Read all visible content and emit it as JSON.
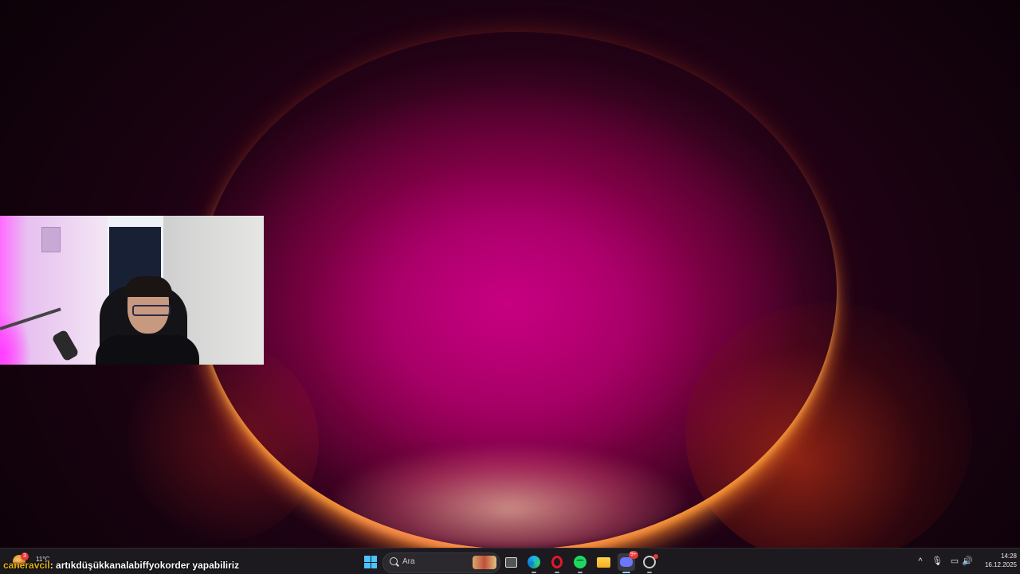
{
  "weather": {
    "temperature": "11°C",
    "badge": "3",
    "icon": "weather-sun-icon"
  },
  "chat": {
    "user": "caneravcil",
    "message": ": artıkdüşükkanalabiffyokorder yapabiliriz"
  },
  "taskbar": {
    "search_placeholder": "Ara",
    "apps": [
      {
        "name": "Windows Start",
        "icon": "windows-logo-icon"
      },
      {
        "name": "Task View",
        "icon": "task-view-icon"
      },
      {
        "name": "Microsoft Edge",
        "icon": "edge-icon"
      },
      {
        "name": "Opera GX",
        "icon": "opera-icon"
      },
      {
        "name": "Spotify",
        "icon": "spotify-icon"
      },
      {
        "name": "File Explorer",
        "icon": "folder-icon"
      },
      {
        "name": "Discord",
        "icon": "discord-icon",
        "badge": "9+"
      },
      {
        "name": "GitHub Desktop",
        "icon": "github-icon"
      }
    ],
    "discord_badge": "9+"
  },
  "tray": {
    "time": "14:28",
    "date": "16.12.2025",
    "chevron_glyph": "^",
    "mic_glyph": "🎙",
    "net_glyph": "▭",
    "vol_glyph": "🔊"
  },
  "colors": {
    "accent": "#4cc2ff",
    "chat_user": "#e0b21a",
    "badge": "#e53935"
  }
}
